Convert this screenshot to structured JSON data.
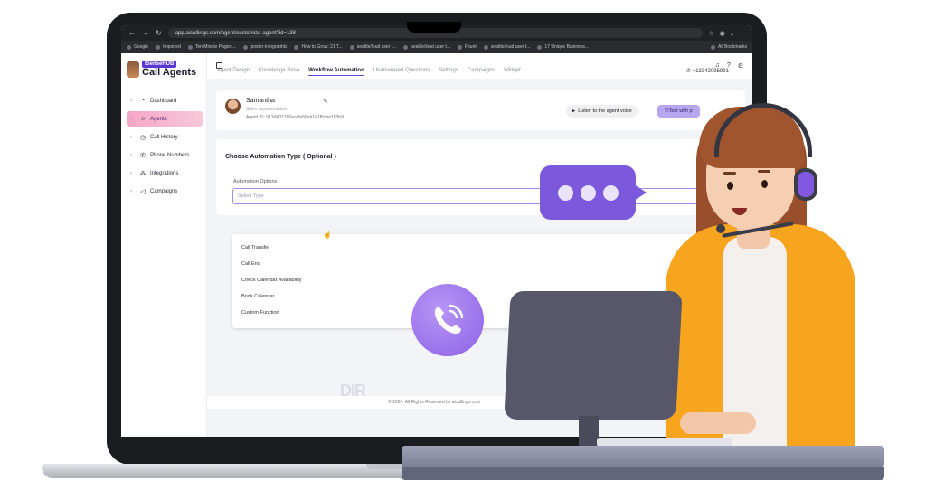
{
  "browser": {
    "url": "app.aicallings.com/agent/customize-agent?id=138",
    "bookmarks": [
      "Google",
      "Imported",
      "Ten Minute Pages:...",
      "poster-infographic",
      "How to Grow: 21 T...",
      "seattle/loud user t...",
      "seattle/loud user t...",
      "Fount",
      "seattle/loud user t...",
      "17 Unique Business..."
    ],
    "all_bookmarks": "All Bookmarks"
  },
  "logo": {
    "brand": "iSenseHUB",
    "title": "Call Agents"
  },
  "sidebar": {
    "items": [
      {
        "label": "Dashboard",
        "icon": "dashboard-icon"
      },
      {
        "label": "Agents",
        "icon": "agents-icon"
      },
      {
        "label": "Call History",
        "icon": "history-icon"
      },
      {
        "label": "Phone Numbers",
        "icon": "phone-icon"
      },
      {
        "label": "Integrations",
        "icon": "integrations-icon"
      },
      {
        "label": "Campaigns",
        "icon": "megaphone-icon"
      }
    ]
  },
  "tabs": [
    "Agent Design",
    "Knowledge Base",
    "Workflow Automation",
    "Unanswered Questions",
    "Settings",
    "Campaigns",
    "Widget"
  ],
  "phone_number": "+13342095991",
  "agent": {
    "name": "Samantha",
    "role": "Sales representative",
    "id_text": "Agent ID: 013d407166ec4fa56eb1e1f6cbe183b9",
    "listen_label": "Listen to the agent voice",
    "test_label": "Test with p"
  },
  "automation": {
    "title": "Choose Automation Type ( Optional )",
    "field_label": "Automation Options",
    "placeholder": "Select Type",
    "options": [
      "Call Transfer",
      "Call End",
      "Check Calendar Availability",
      "Book Calendar",
      "Custom Function"
    ]
  },
  "overlay_text": "DIR",
  "footer_text": "© 2024. All Rights Reserved by aicallings.com",
  "colors": {
    "accent": "#6a3fe0",
    "bubble": "#7b58dc",
    "jacket": "#f7a51f"
  }
}
